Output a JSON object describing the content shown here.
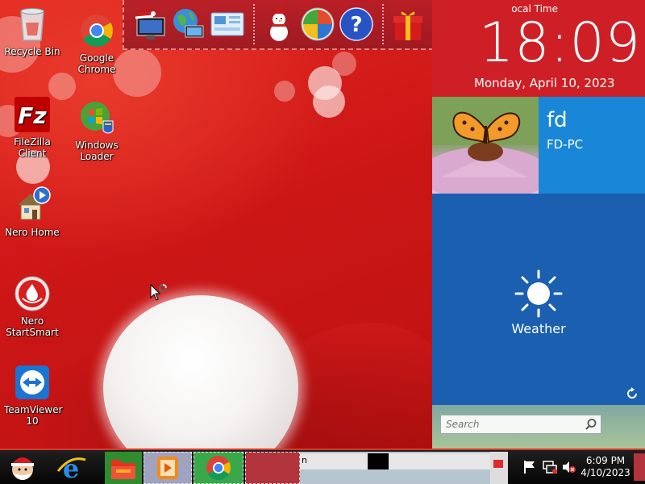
{
  "desktop": {
    "icons": [
      {
        "label": "Recycle Bin",
        "icon": "recycle-bin-icon"
      },
      {
        "label": "Google Chrome",
        "icon": "chrome-icon"
      },
      {
        "label": "FileZilla Client",
        "icon": "filezilla-icon"
      },
      {
        "label": "Windows Loader",
        "icon": "windows-loader-icon"
      },
      {
        "label": "Nero Home",
        "icon": "nero-home-icon"
      },
      {
        "label": "Nero StartSmart",
        "icon": "nero-startsmart-icon"
      },
      {
        "label": "TeamViewer 10",
        "icon": "teamviewer-icon"
      }
    ]
  },
  "dock": {
    "items": [
      "santa-monitor-icon",
      "globe-network-icon",
      "control-panel-icon",
      "snowman-icon",
      "windows-shield-icon",
      "help-icon",
      "gift-icon",
      "folder-icon",
      "recycle-bin-icon"
    ]
  },
  "metro": {
    "clock_caption": "ocal Time",
    "time": "18:09",
    "date": "Monday, April 10, 2023",
    "user_name": "fd",
    "computer_name": "FD-PC",
    "weather_label": "Weather",
    "search_placeholder": "Search"
  },
  "taskbar": {
    "window_label": "n",
    "tray_time": "6:09 PM",
    "tray_date": "4/10/2023"
  },
  "colors": {
    "wallpaper_red": "#c61a1a",
    "clock_tile": "#cf1f26",
    "user_tile": "#1a86d8",
    "weather_tile": "#1b5fb0",
    "taskbar": "#0a0a0a"
  }
}
